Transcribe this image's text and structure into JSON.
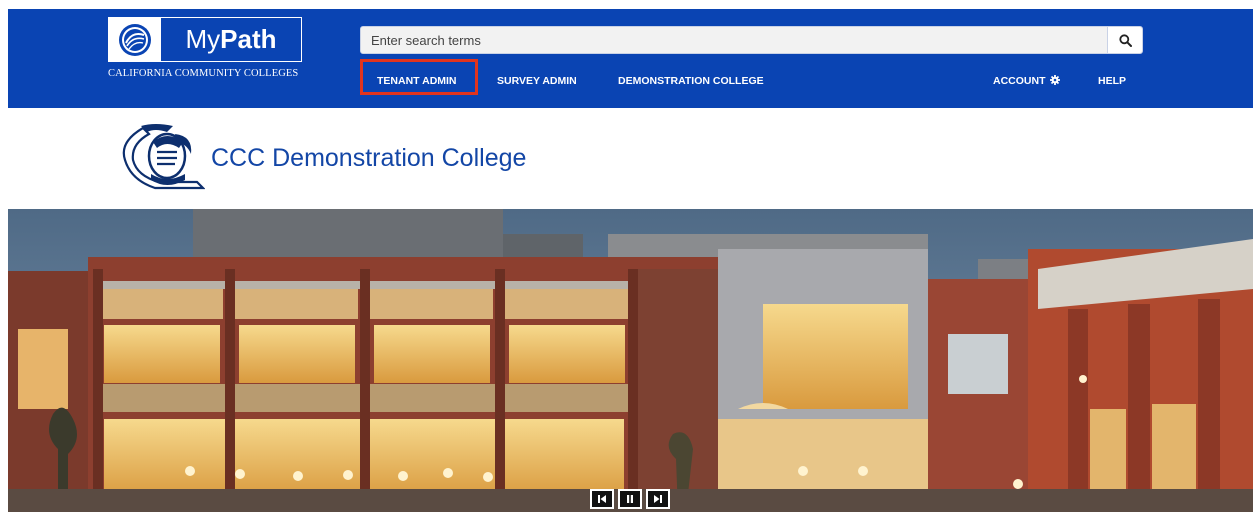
{
  "header": {
    "brand": {
      "name_prefix": "My",
      "name_bold": "Path",
      "subtitle": "CALIFORNIA COMMUNITY COLLEGES"
    },
    "search": {
      "placeholder": "Enter search terms",
      "value": ""
    },
    "nav": {
      "tenant_admin": "TENANT ADMIN",
      "survey_admin": "SURVEY ADMIN",
      "demonstration_college": "DEMONSTRATION COLLEGE",
      "account": "ACCOUNT",
      "help": "HELP"
    },
    "highlighted_nav_item": "TENANT ADMIN",
    "colors": {
      "bar_background": "#0a44b3",
      "highlight_border": "#e0341e",
      "text": "#ffffff"
    }
  },
  "college": {
    "name": "CCC Demonstration College",
    "name_color": "#1346a6"
  },
  "carousel": {
    "image_description_icon": "campus-building-photo",
    "controls": [
      "previous-icon",
      "pause-icon",
      "next-icon"
    ]
  }
}
